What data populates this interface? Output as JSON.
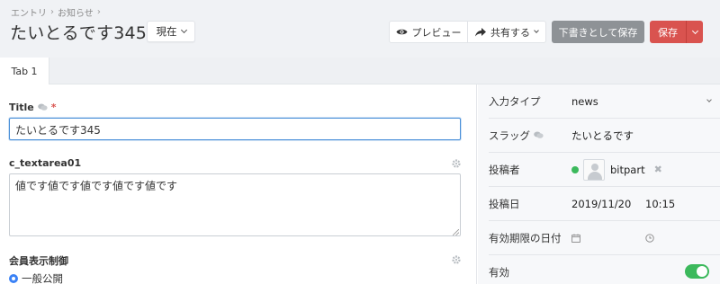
{
  "breadcrumb": {
    "items": [
      "エントリ",
      "お知らせ"
    ],
    "separator": "›"
  },
  "page": {
    "title": "たいとるです345"
  },
  "version_select": {
    "value": "現在"
  },
  "toolbar": {
    "preview_label": "プレビュー",
    "share_label": "共有する",
    "draft_label": "下書きとして保存",
    "save_label": "保存"
  },
  "tabs": [
    {
      "label": "Tab 1"
    }
  ],
  "fields": {
    "title": {
      "label": "Title",
      "required_mark": "*",
      "value": "たいとるです345"
    },
    "textarea": {
      "label": "c_textarea01",
      "value": "値です値です値です値です値です"
    },
    "member": {
      "label": "会員表示制御",
      "option": "一般公開"
    }
  },
  "sidebar": {
    "type": {
      "label": "入力タイプ",
      "value": "news"
    },
    "slug": {
      "label": "スラッグ",
      "value": "たいとるです"
    },
    "author": {
      "label": "投稿者",
      "value": "bitpart"
    },
    "date": {
      "label": "投稿日",
      "date": "2019/11/20",
      "time": "10:15"
    },
    "expiry": {
      "label": "有効期限の日付"
    },
    "enabled": {
      "label": "有効",
      "on": true
    }
  },
  "colors": {
    "save": "#d9534f",
    "draft": "#8e9296",
    "toggle_on": "#3cb95c",
    "focus": "#4a90d9"
  }
}
